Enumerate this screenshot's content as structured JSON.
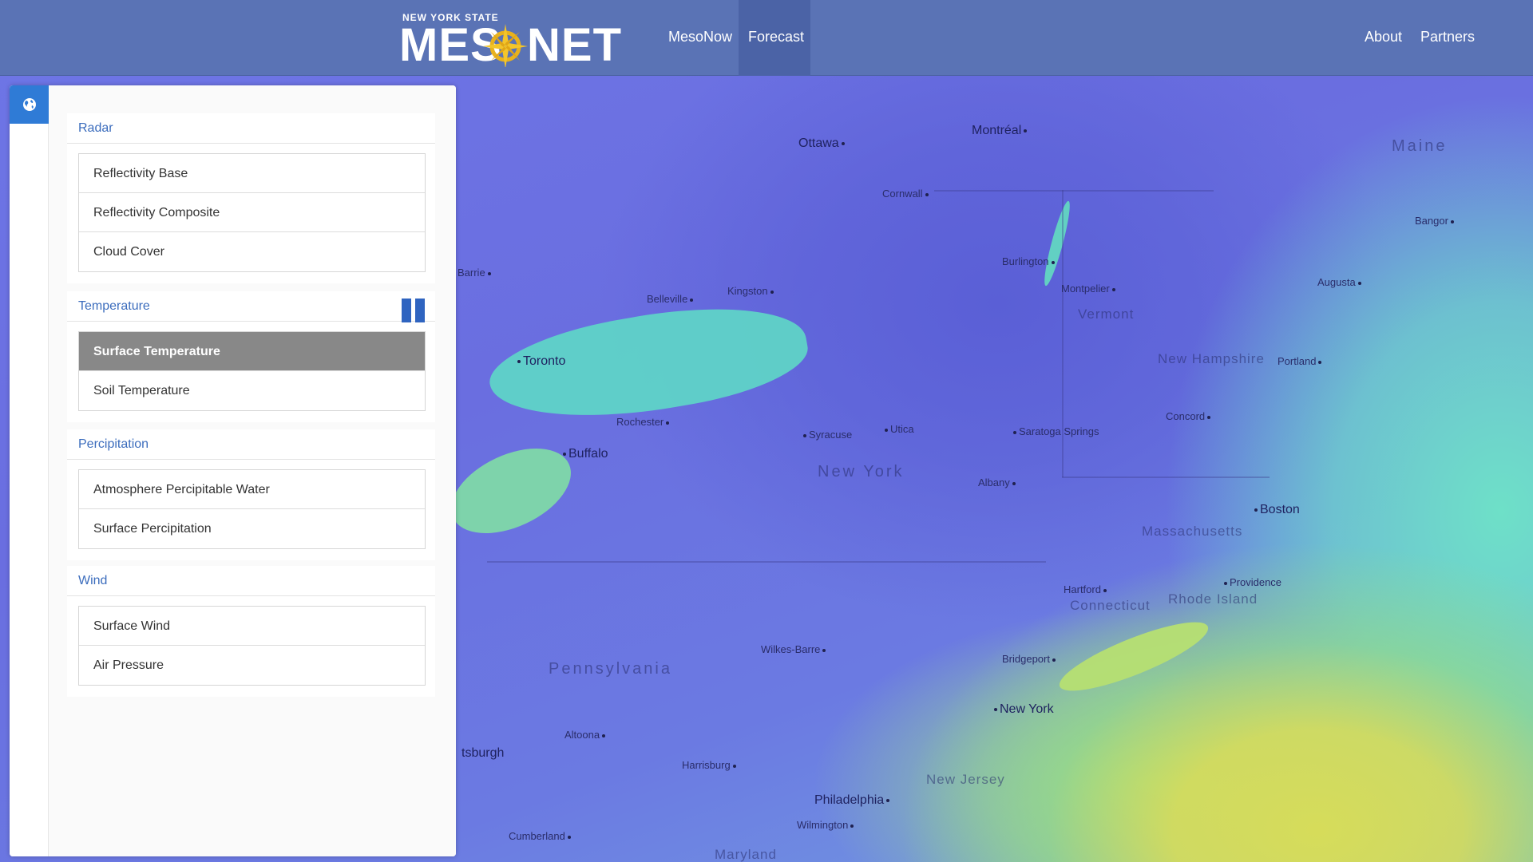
{
  "header": {
    "logo_top": "NEW YORK STATE",
    "logo_left": "MES",
    "logo_right": "NET",
    "nav_left": [
      "MesoNow",
      "Forecast"
    ],
    "nav_right": [
      "About",
      "Partners"
    ],
    "active_nav": "Forecast"
  },
  "panel": {
    "globe_tab_icon": "globe-icon",
    "sections": [
      {
        "title": "Radar",
        "items": [
          "Reflectivity Base",
          "Reflectivity Composite",
          "Cloud Cover"
        ]
      },
      {
        "title": "Temperature",
        "items": [
          "Surface Temperature",
          "Soil Temperature"
        ],
        "selected": "Surface Temperature",
        "control_icon": "pause-icon"
      },
      {
        "title": "Percipitation",
        "items": [
          "Atmosphere Percipitable Water",
          "Surface Percipitation"
        ]
      },
      {
        "title": "Wind",
        "items": [
          "Surface Wind",
          "Air Pressure"
        ]
      }
    ]
  },
  "map": {
    "cities": [
      "Ottawa",
      "Montréal",
      "Cornwall",
      "Burlington",
      "Montpelier",
      "Bangor",
      "Augusta",
      "Barrie",
      "Belleville",
      "Kingston",
      "Toronto",
      "Rochester",
      "Syracuse",
      "Utica",
      "Saratoga Springs",
      "Concord",
      "Portland",
      "Buffalo",
      "Albany",
      "Boston",
      "Hartford",
      "Providence",
      "Wilkes-Barre",
      "Bridgeport",
      "New York",
      "Altoona",
      "Harrisburg",
      "Philadelphia",
      "Wilmington",
      "Cumberland",
      "tsburgh"
    ],
    "states": [
      "Maine",
      "Vermont",
      "New Hampshire",
      "New York",
      "Massachusetts",
      "Connecticut",
      "Rhode Island",
      "Pennsylvania",
      "New Jersey",
      "Maryland"
    ],
    "colors": {
      "low": "#6a6ee0",
      "water": "#5fd3c7",
      "high": "#d6dc5a"
    }
  }
}
